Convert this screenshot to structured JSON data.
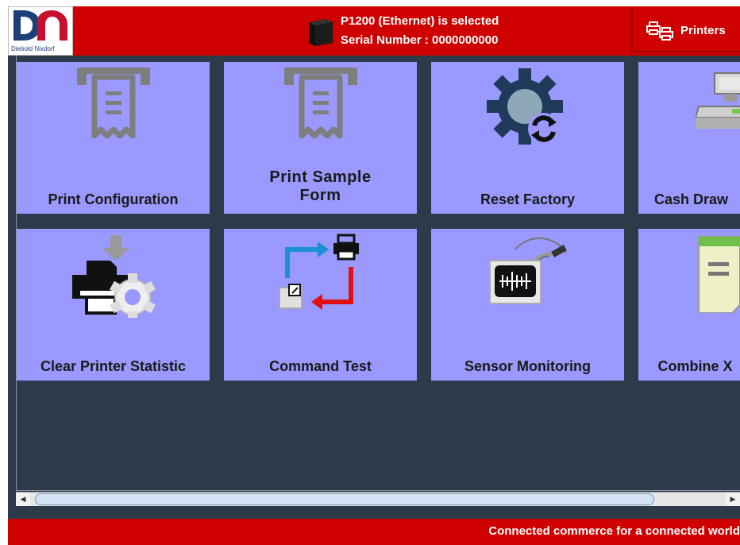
{
  "header": {
    "logo_text": "Diebold Nixdorf",
    "selected_printer": "P1200 (Ethernet) is selected",
    "serial_number": "Serial Number : 0000000000",
    "printers_label": "Printers"
  },
  "tiles": [
    {
      "label": "Print Configuration",
      "icon": "receipt-icon"
    },
    {
      "label_line1": "Print Sample",
      "label_line2": "Form",
      "icon": "receipt-icon"
    },
    {
      "label": "Reset Factory",
      "icon": "gear-reset-icon"
    },
    {
      "label": "Cash Draw",
      "icon": "cash-drawer-icon"
    },
    {
      "label": "Clear Printer Statistic",
      "icon": "printer-gear-icon"
    },
    {
      "label": "Command Test",
      "icon": "command-test-icon"
    },
    {
      "label": "Sensor Monitoring",
      "icon": "sensor-icon"
    },
    {
      "label": "Combine X",
      "icon": "document-icon"
    }
  ],
  "footer": {
    "tagline": "Connected commerce for a connected world"
  },
  "colors": {
    "brand_red": "#cf0000",
    "tile_bg": "#9999ff",
    "background": "#2e3a4a"
  }
}
